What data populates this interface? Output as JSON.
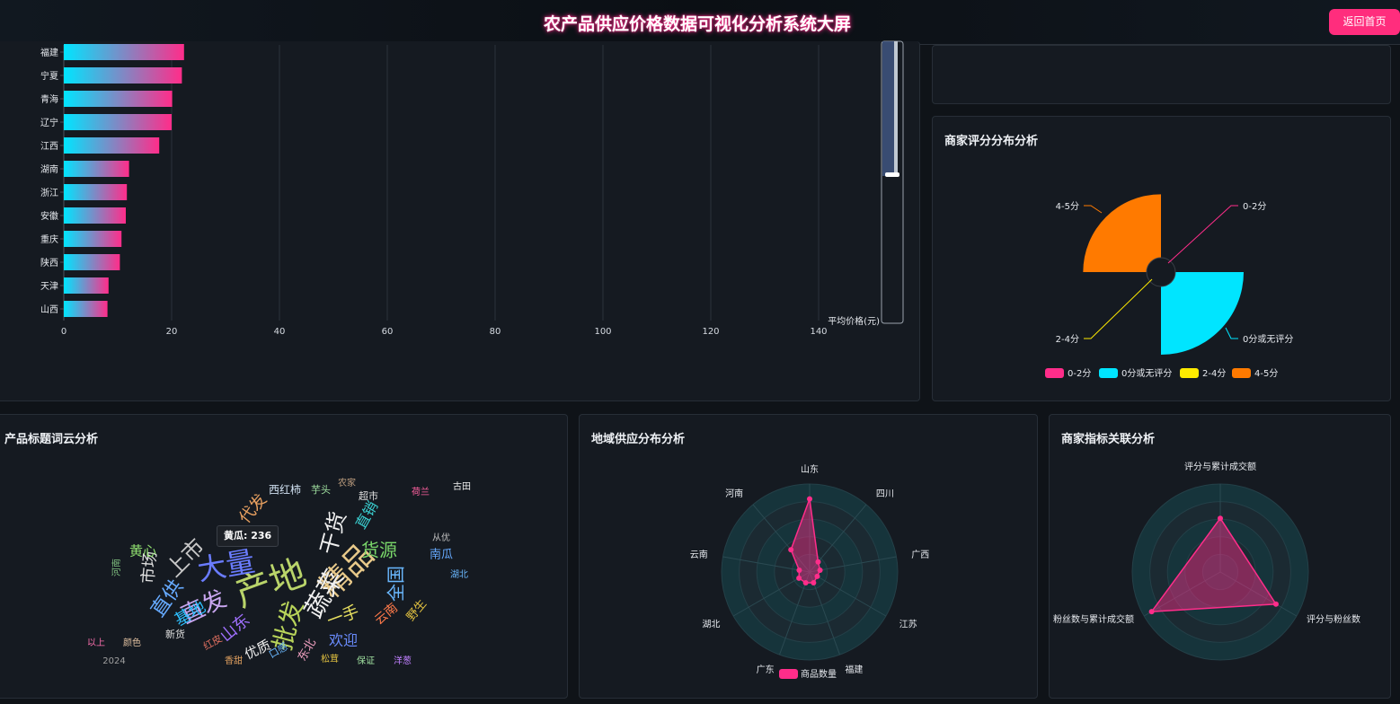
{
  "page": {
    "title": "农产品供应价格数据可视化分析系统大屏",
    "home_button": "返回首页"
  },
  "colors": {
    "pink": "#ff2d8a",
    "cyan": "#00e5ff",
    "yellow": "#ffeb00",
    "orange": "#ff7a00"
  },
  "panels": {
    "rating": "商家评分分布分析",
    "wordcloud": "产品标题词云分析",
    "region": "地域供应分布分析",
    "merchant": "商家指标关联分析"
  },
  "chart_data": [
    {
      "type": "bar",
      "orientation": "horizontal",
      "categories": [
        "福建",
        "宁夏",
        "青海",
        "辽宁",
        "江西",
        "湖南",
        "浙江",
        "安徽",
        "重庆",
        "陕西",
        "天津",
        "山西"
      ],
      "values": [
        22.3,
        21.9,
        20.1,
        20.0,
        17.7,
        12.1,
        11.7,
        11.5,
        10.7,
        10.4,
        8.3,
        8.1
      ],
      "xlim": [
        0,
        150
      ],
      "xticks": [
        0,
        20,
        40,
        60,
        80,
        100,
        120,
        140
      ],
      "slider_label": "平均价格(元)",
      "grid": true
    },
    {
      "type": "pie",
      "variant": "rose",
      "title": "商家评分分布分析",
      "labels": [
        "0-2分",
        "0分或无评分",
        "2-4分",
        "4-5分"
      ],
      "values": [
        0,
        100,
        0,
        93
      ],
      "colors": [
        "#ff2d8a",
        "#00e5ff",
        "#ffeb00",
        "#ff7a00"
      ],
      "legend": "bottom"
    },
    {
      "type": "wordcloud",
      "title": "产品标题词云分析",
      "tooltip": "黄瓜: 236",
      "words": [
        {
          "text": "产地",
          "color": "#b9d46a",
          "size": 40
        },
        {
          "text": "精品",
          "color": "#e8c98a",
          "size": 34
        },
        {
          "text": "大量",
          "color": "#6a7cff",
          "size": 32
        },
        {
          "text": "批发",
          "color": "#b8d45a",
          "size": 28
        },
        {
          "text": "蔬菜",
          "color": "#f0f0f0",
          "size": 28
        },
        {
          "text": "直发",
          "color": "#c9a6f0",
          "size": 26
        },
        {
          "text": "上市",
          "color": "#c8c8c8",
          "size": 24
        },
        {
          "text": "干货",
          "color": "#f0f0f0",
          "size": 24
        },
        {
          "text": "直供",
          "color": "#66aaff",
          "size": 22
        },
        {
          "text": "货源",
          "color": "#7ad86a",
          "size": 20
        },
        {
          "text": "全国",
          "color": "#6ab8ff",
          "size": 20
        },
        {
          "text": "市场",
          "color": "#e0e0e0",
          "size": 18
        },
        {
          "text": "一手",
          "color": "#e8e060",
          "size": 18
        },
        {
          "text": "基地",
          "color": "#2ec0ff",
          "size": 18
        },
        {
          "text": "山东",
          "color": "#a070ff",
          "size": 18
        },
        {
          "text": "代发",
          "color": "#e8a060",
          "size": 18
        },
        {
          "text": "直销",
          "color": "#3acfd0",
          "size": 16
        },
        {
          "text": "欢迎",
          "color": "#6a8cff",
          "size": 16
        },
        {
          "text": "优质",
          "color": "#f0f0f0",
          "size": 15
        },
        {
          "text": "黄心",
          "color": "#90e070",
          "size": 15
        },
        {
          "text": "云南",
          "color": "#ff7a4a",
          "size": 14
        },
        {
          "text": "南瓜",
          "color": "#66aaff",
          "size": 13
        },
        {
          "text": "东北",
          "color": "#f0a0c0",
          "size": 13
        },
        {
          "text": "野生",
          "color": "#e0c040",
          "size": 13
        },
        {
          "text": "西红柿",
          "color": "#d0e0f0",
          "size": 12
        },
        {
          "text": "芋头",
          "color": "#a0e0a0",
          "size": 11
        },
        {
          "text": "超市",
          "color": "#e0e0e0",
          "size": 11
        },
        {
          "text": "新货",
          "color": "#e0e0e0",
          "size": 11
        },
        {
          "text": "口感",
          "color": "#6ab8ff",
          "size": 11
        },
        {
          "text": "红皮",
          "color": "#e07060",
          "size": 11
        },
        {
          "text": "香甜",
          "color": "#e0a060",
          "size": 10
        },
        {
          "text": "松茸",
          "color": "#e0c040",
          "size": 10
        },
        {
          "text": "保证",
          "color": "#a0e0a0",
          "size": 10
        },
        {
          "text": "洋葱",
          "color": "#c080ff",
          "size": 10
        },
        {
          "text": "从优",
          "color": "#c0c0c0",
          "size": 10
        },
        {
          "text": "湖北",
          "color": "#6ab8ff",
          "size": 10
        },
        {
          "text": "古田",
          "color": "#f0f0f0",
          "size": 10
        },
        {
          "text": "荷兰",
          "color": "#ff60a0",
          "size": 10
        },
        {
          "text": "农家",
          "color": "#c0a080",
          "size": 10
        },
        {
          "text": "以上",
          "color": "#ff70b0",
          "size": 10
        },
        {
          "text": "颜色",
          "color": "#e0c0a0",
          "size": 10
        },
        {
          "text": "2024",
          "color": "#a0a0a0",
          "size": 10
        },
        {
          "text": "河南",
          "color": "#80c080",
          "size": 10
        }
      ]
    },
    {
      "type": "radar",
      "title": "地域供应分布分析",
      "indicators": [
        "山东",
        "四川",
        "广西",
        "江苏",
        "福建",
        "湖北",
        "广东",
        "云南",
        "河南"
      ],
      "layout_order": [
        "山东",
        "四川",
        "广西",
        "江苏",
        "福建",
        "广东",
        "湖北",
        "云南",
        "河南"
      ],
      "series": [
        {
          "name": "商品数量",
          "values": [
            0.83,
            0.15,
            0.12,
            0.1,
            0.13,
            0.14,
            0.13,
            0.12,
            0.33
          ]
        }
      ],
      "max": 1
    },
    {
      "type": "radar",
      "title": "商家指标关联分析",
      "indicators": [
        "评分与累计成交额",
        "评分与粉丝数",
        "粉丝数与累计成交额"
      ],
      "values": [
        0.61,
        0.73,
        0.9
      ],
      "max": 1
    }
  ]
}
